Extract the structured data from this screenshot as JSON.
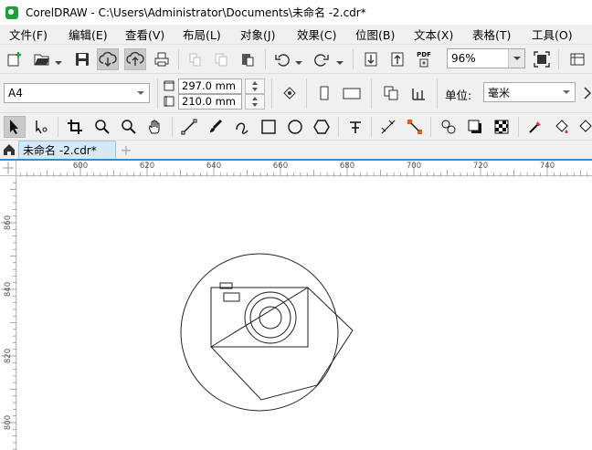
{
  "window": {
    "title": "CorelDRAW - C:\\Users\\Administrator\\Documents\\未命名 -2.cdr*"
  },
  "menu": [
    {
      "label": "文件(F)"
    },
    {
      "label": "编辑(E)"
    },
    {
      "label": "查看(V)"
    },
    {
      "label": "布局(L)"
    },
    {
      "label": "对象(J)"
    },
    {
      "label": "效果(C)"
    },
    {
      "label": "位图(B)"
    },
    {
      "label": "文本(X)"
    },
    {
      "label": "表格(T)"
    },
    {
      "label": "工具(O)"
    }
  ],
  "standard_toolbar": {
    "zoom_value": "96%",
    "pdf_label": "PDF"
  },
  "property_bar": {
    "page_size": "A4",
    "page_height": "297.0 mm",
    "page_width": "210.0 mm",
    "units_label": "单位:",
    "units_value": "毫米"
  },
  "tabs": {
    "document_tab": "未命名 -2.cdr*",
    "add_tab": "+"
  },
  "ruler": {
    "h_labels": [
      "600",
      "620",
      "640",
      "660",
      "680",
      "700",
      "720",
      "740"
    ],
    "v_labels": [
      "860",
      "840",
      "820",
      "800"
    ]
  },
  "icons": {
    "new": "new-document-icon",
    "open": "open-folder-icon",
    "save": "save-icon",
    "cloud_down": "cloud-download-icon",
    "cloud_up": "cloud-upload-icon",
    "print": "print-icon",
    "undo": "undo-icon",
    "redo": "redo-icon",
    "import": "import-icon",
    "export": "export-icon"
  },
  "colors": {
    "tab_accent": "#2d8fd5",
    "tab_bg": "#d4e8f7",
    "logo_green": "#1f9e3a"
  }
}
